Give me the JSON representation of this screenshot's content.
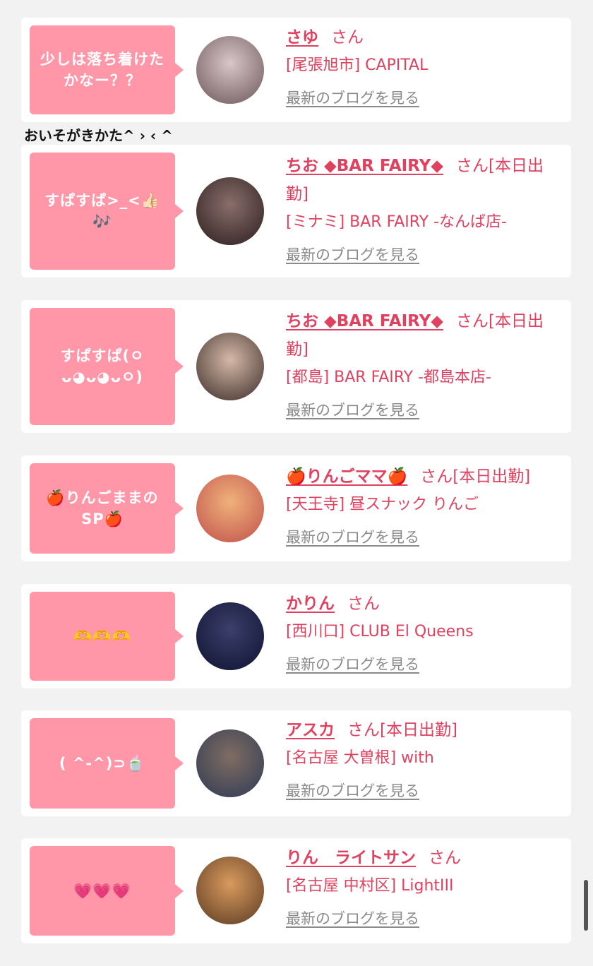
{
  "standalone_caption": "おいそがきかた^ › ‹ ^",
  "blog_link_label": "最新のブログを見る",
  "cards": [
    {
      "bubble_text": "少しは落ち着けたかなー？？",
      "name": "さゆ",
      "suffix": "さん",
      "shop": "[尾張旭市] CAPITAL",
      "avatar_colors": [
        "#d8c6c8",
        "#6b5658"
      ]
    },
    {
      "bubble_text": "すぱすぱ>_<👍🏻🎶",
      "name": "ちお ◆BAR FAIRY◆",
      "suffix": "さん[本日出勤]",
      "shop": "[ミナミ] BAR FAIRY -なんば店-",
      "avatar_colors": [
        "#8a6e6a",
        "#2a1e1e"
      ]
    },
    {
      "bubble_text": "すぱすぱ(ㅇᴗ◕ᴗ◕ᴗㅇ)",
      "name": "ちお ◆BAR FAIRY◆",
      "suffix": "さん[本日出勤]",
      "shop": "[都島] BAR FAIRY -都島本店-",
      "avatar_colors": [
        "#d6b8a8",
        "#3a2c28"
      ]
    },
    {
      "bubble_text": "🍎りんごままのSP🍎",
      "name": "🍎りんごママ🍎",
      "suffix": "さん[本日出勤]",
      "shop": "[天王寺] 昼スナック りんご",
      "avatar_colors": [
        "#f0b27a",
        "#c0504d"
      ]
    },
    {
      "bubble_text": "🫶🫶🫶",
      "name": "かりん",
      "suffix": "さん",
      "shop": "[西川口] CLUB El Queens",
      "avatar_colors": [
        "#3b3f6b",
        "#0e1230"
      ]
    },
    {
      "bubble_text": "( ^-^)⊃🍵",
      "name": "アスカ",
      "suffix": "さん[本日出勤]",
      "shop": "[名古屋 大曽根] with",
      "avatar_colors": [
        "#7f6d62",
        "#2f3a55"
      ]
    },
    {
      "bubble_text": "💗💗💗",
      "name": "りん　ライトサン",
      "suffix": "さん",
      "shop": "[名古屋 中村区] LightIII",
      "avatar_colors": [
        "#d99a5e",
        "#5a3a22"
      ]
    }
  ]
}
